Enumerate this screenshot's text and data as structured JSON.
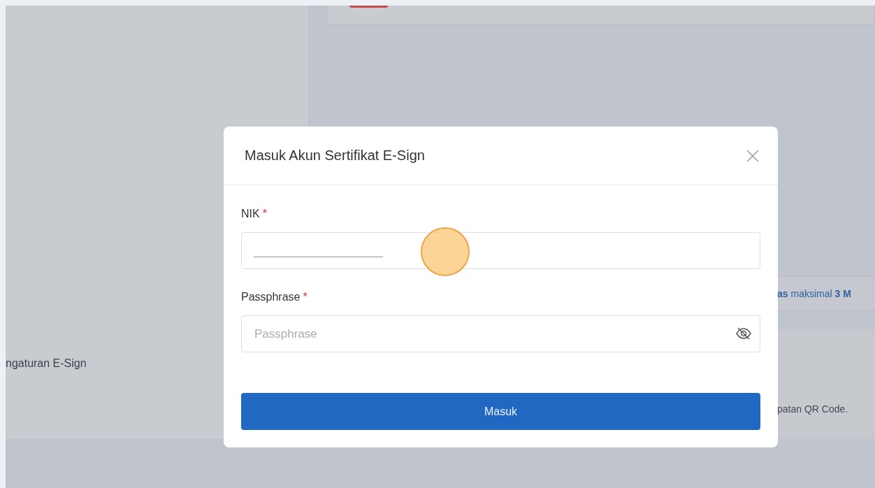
{
  "background_page": {
    "sidebar_text": "ngaturan E-Sign",
    "upload_hint": "**as** maksimal **3 M**",
    "qr_hint": "patan QR Code."
  },
  "dialog": {
    "title": "Masuk Akun Sertifikat E-Sign",
    "fields": [
      {
        "label": "NIK",
        "required": true,
        "required_mark": "*",
        "kind": "text"
      },
      {
        "label": "Passphrase",
        "required": true,
        "required_mark": "*",
        "kind": "password",
        "placeholder": "Passphrase"
      }
    ],
    "submit": "Masuk"
  },
  "click_indicator": true
}
